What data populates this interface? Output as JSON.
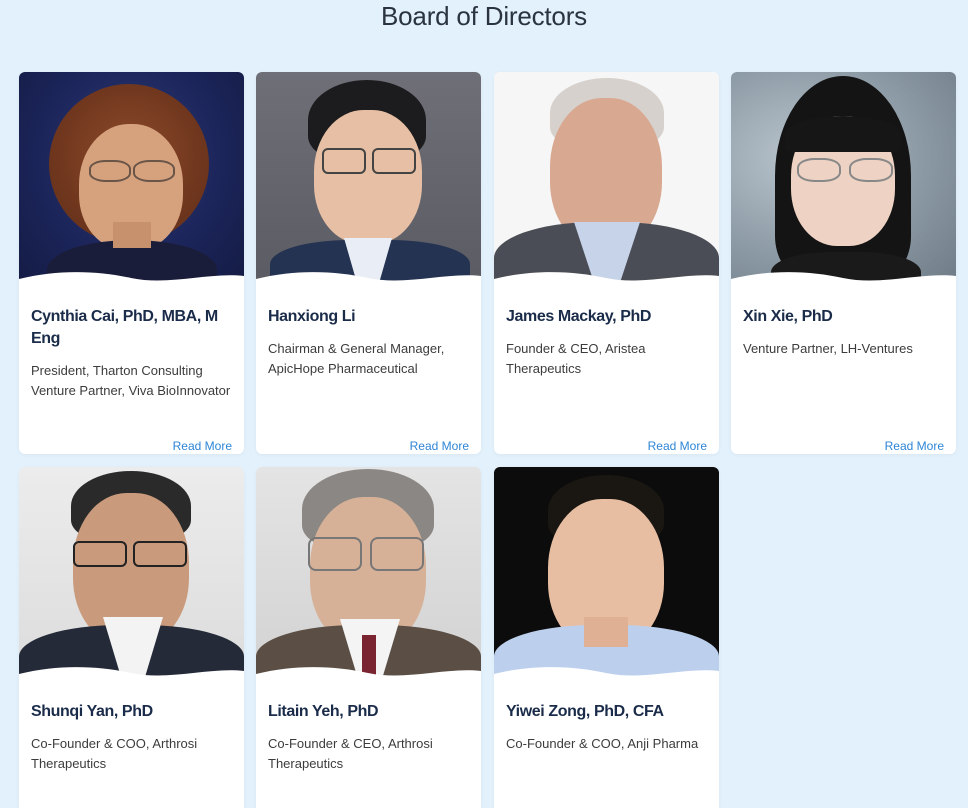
{
  "page": {
    "title": "Board of Directors"
  },
  "directors": [
    {
      "name": "Cynthia Cai, PhD, MBA, M Eng",
      "role": "President, Tharton Consulting\nVenture Partner, Viva BioInnovator",
      "read_more": "Read More"
    },
    {
      "name": "Hanxiong Li",
      "role": "Chairman & General Manager, ApicHope Pharmaceutical",
      "read_more": "Read More"
    },
    {
      "name": "James Mackay, PhD",
      "role": "Founder & CEO, Aristea Therapeutics",
      "read_more": "Read More"
    },
    {
      "name": "Xin Xie, PhD",
      "role": "Venture Partner, LH-Ventures",
      "read_more": "Read More"
    },
    {
      "name": "Shunqi Yan, PhD",
      "role": "Co-Founder & COO, Arthrosi Therapeutics"
    },
    {
      "name": "Litain Yeh, PhD",
      "role": "Co-Founder & CEO, Arthrosi Therapeutics"
    },
    {
      "name": "Yiwei Zong, PhD, CFA",
      "role": "Co-Founder & COO, Anji Pharma"
    }
  ]
}
